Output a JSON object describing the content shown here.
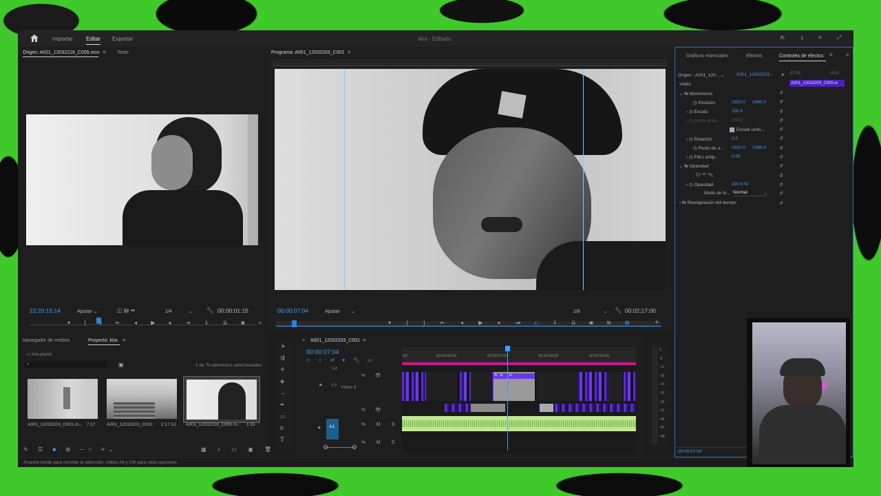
{
  "topbar": {
    "home_label": "Inicio",
    "tabs": [
      "Importar",
      "Editar",
      "Exportar"
    ],
    "title": "kira",
    "title_suffix": "- Editado"
  },
  "source": {
    "tab_label": "Origen: A001_12032218_C005.mov",
    "tab2_label": "Texto",
    "timecode": "22:20:15:14",
    "fit": "Ajustar",
    "resolution": "1/4",
    "duration": "00:00:01:15"
  },
  "program": {
    "tab_label": "Programa: A001_12032203_C001",
    "timecode": "00:00:07:04",
    "fit": "Ajustar",
    "resolution": "1/8",
    "duration": "00:02:17:00"
  },
  "effects": {
    "tabs": [
      "Gráficos esenciales",
      "Efectos",
      "Controles de efectos"
    ],
    "source_label": "Origen - A001_120...",
    "clip_label": "A001_12032203...",
    "clip_bar_label": "A001_12032203_C005.m",
    "video_label": "Vídeo",
    "time_label": "07:03",
    "time_label2": "00:0",
    "movement": "Movimiento",
    "position_label": "Posición",
    "position_x": "1920.0",
    "position_y": "1080.0",
    "scale_label": "Escala",
    "scale_value": "100.0",
    "scale_width_label": "Anchura de...",
    "scale_width_value": "100.0",
    "uniform_label": "Escala unifo...",
    "rotation_label": "Rotación",
    "rotation_value": "0.0",
    "anchor_label": "Punto de a...",
    "anchor_x": "1920.0",
    "anchor_y": "1080.0",
    "antiflicker_label": "Filtro antip...",
    "antiflicker_value": "0.00",
    "opacity_group": "Opacidad",
    "opacity_label": "Opacidad",
    "opacity_value": "100.0 %",
    "blend_label": "Modo de fu...",
    "blend_value": "Normal",
    "time_remap": "Reasignación del tiempo",
    "bottom_time": "00:00:07:04"
  },
  "project": {
    "tabs": [
      "Navegador de medios",
      "Proyecto: kira"
    ],
    "file": "kira.prproj",
    "selection_status": "1 de 70 elementos seleccionados",
    "items": [
      {
        "name": "A001_12032203_C001.m...",
        "duration": "7:17"
      },
      {
        "name": "A001_12032203_C001",
        "duration": "2:17:12"
      },
      {
        "name": "A001_12032218_C005.m...",
        "duration": "1:15"
      }
    ]
  },
  "timeline": {
    "tab_label": "A001_12032203_C001",
    "timecode": "00:00:07:04",
    "ruler": [
      ":00",
      "00:00:06:00",
      "00:00:07:00",
      "00:00:08:00",
      "00:00:09:00"
    ],
    "tracks": [
      "V4",
      "V3",
      "A1"
    ],
    "v3_name": "Vídeo 3",
    "meter_labels": [
      "0",
      "-6",
      "-12",
      "-18",
      "-24",
      "-30",
      "-36",
      "-42",
      "-48",
      "-54",
      "-dB"
    ]
  },
  "status_bar": "Arrastre borde para recortar la selección. Utilice Alt y Ctrl para otras opciones.",
  "colors": {
    "accent": "#3f9cff",
    "clip_purple": "#5a2ad0",
    "audio_green": "#b8e68a",
    "timeline_magenta": "#c41a8a",
    "background_green": "#3fc92a"
  }
}
